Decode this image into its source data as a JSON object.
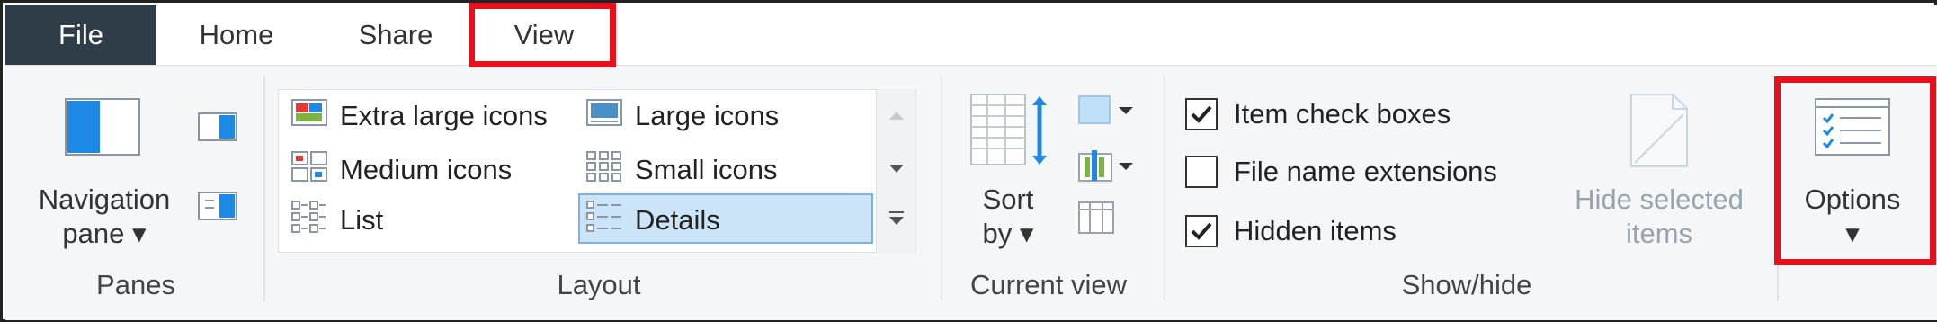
{
  "tabs": {
    "file": "File",
    "home": "Home",
    "share": "Share",
    "view": "View"
  },
  "panes": {
    "navigation_pane_line1": "Navigation",
    "navigation_pane_line2": "pane ▾",
    "group_label": "Panes"
  },
  "layout": {
    "items": {
      "extra_large_icons": "Extra large icons",
      "large_icons": "Large icons",
      "medium_icons": "Medium icons",
      "small_icons": "Small icons",
      "list": "List",
      "details": "Details"
    },
    "selected": "Details",
    "group_label": "Layout"
  },
  "current_view": {
    "sort_by_line1": "Sort",
    "sort_by_line2": "by ▾",
    "group_label": "Current view"
  },
  "show_hide": {
    "item_check_boxes": "Item check boxes",
    "item_check_boxes_checked": true,
    "file_name_extensions": "File name extensions",
    "file_name_extensions_checked": false,
    "hidden_items": "Hidden items",
    "hidden_items_checked": true,
    "hide_selected_line1": "Hide selected",
    "hide_selected_line2": "items",
    "group_label": "Show/hide"
  },
  "options": {
    "label": "Options",
    "arrow": "▾"
  },
  "colors": {
    "file_tab": "#2f3d48",
    "highlight": "#e8101c",
    "ribbon_bg": "#f4f6f8",
    "selection": "#cce4f7",
    "accent_blue": "#1e88e5"
  }
}
